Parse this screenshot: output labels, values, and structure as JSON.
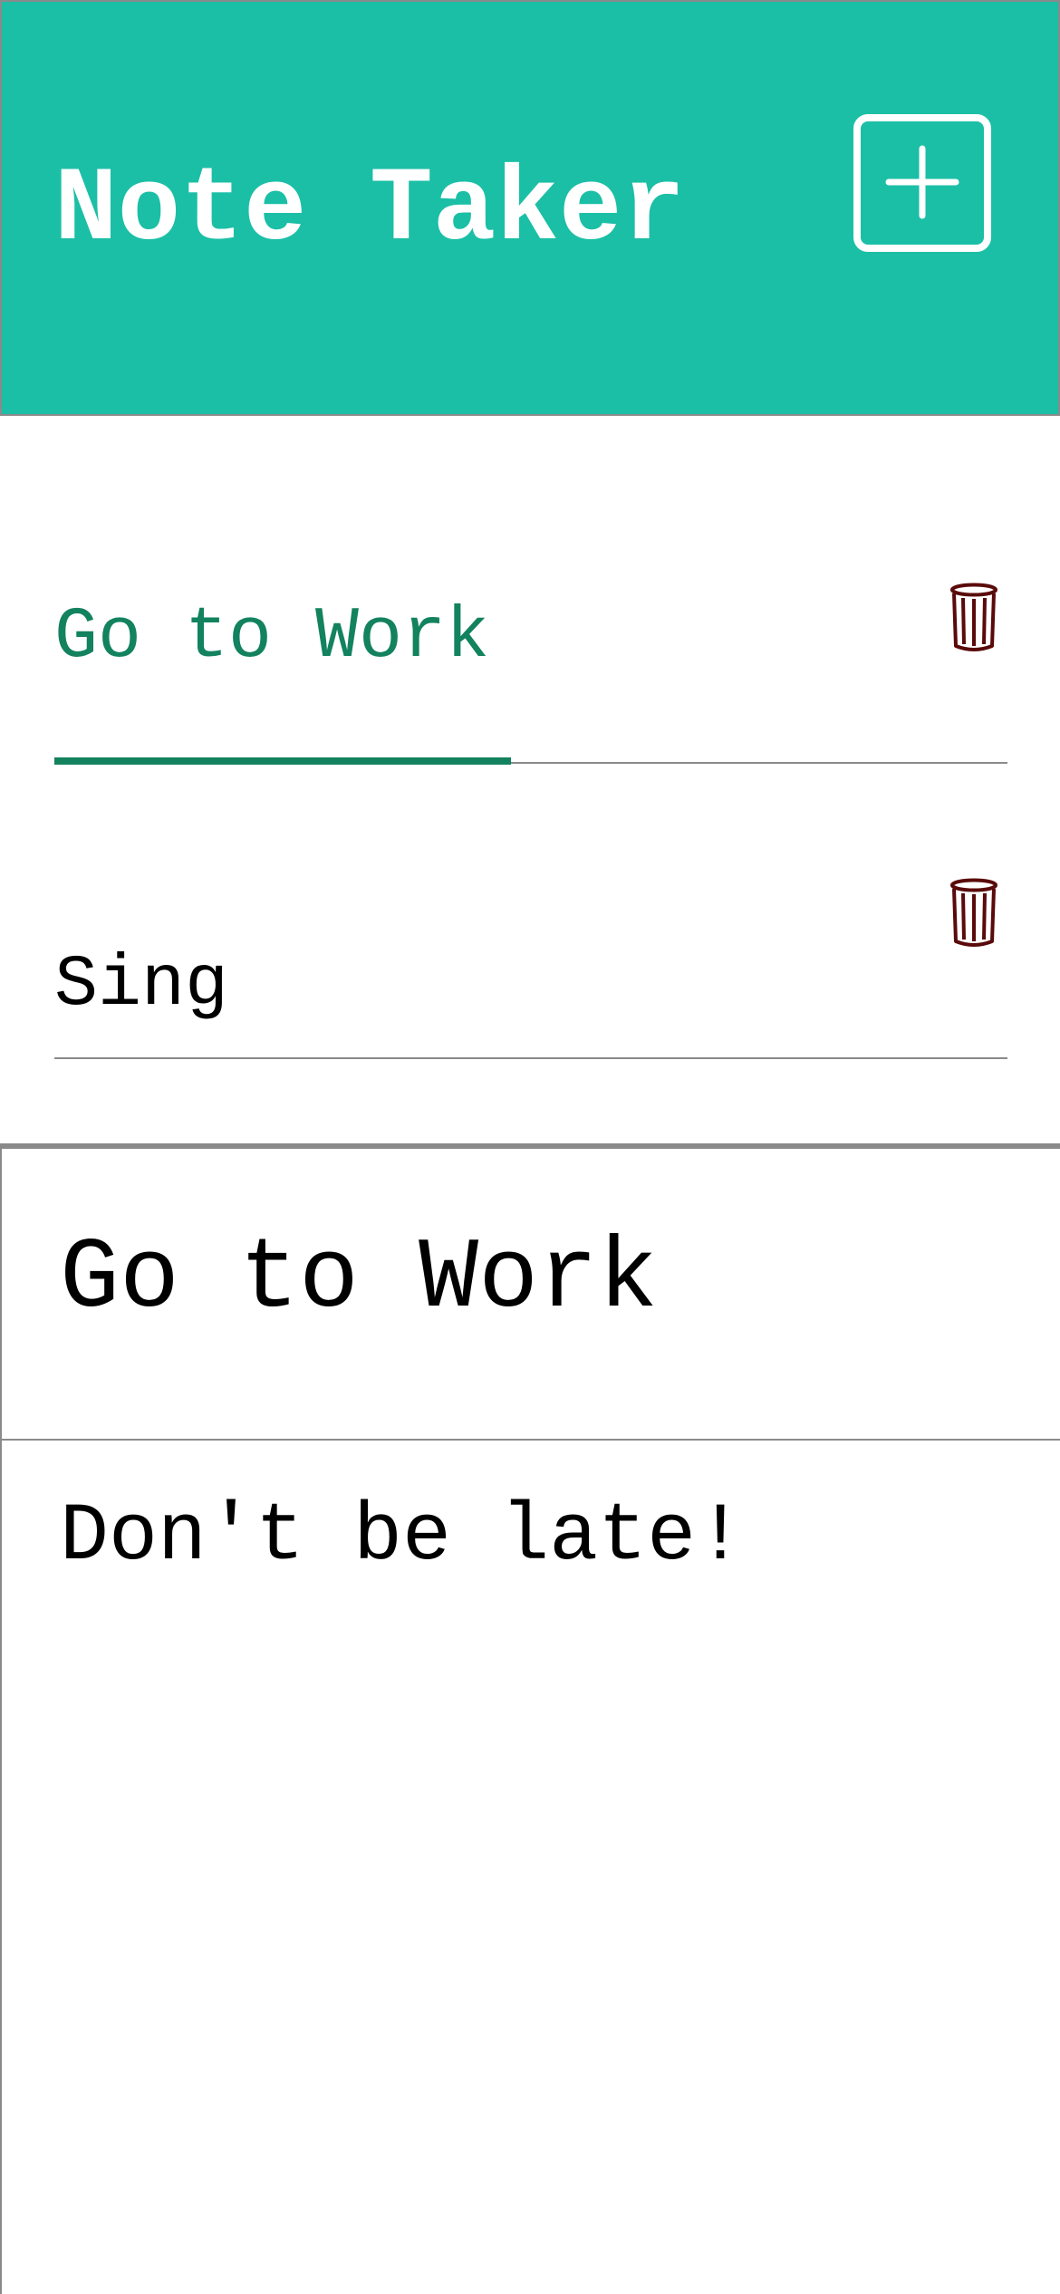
{
  "header": {
    "title": "Note Taker",
    "add_icon": "plus-square-icon",
    "background_color": "#1bbfa6"
  },
  "notes": [
    {
      "title": "Go to Work",
      "active": true,
      "delete_icon": "trash-icon"
    },
    {
      "title": "Sing",
      "active": false,
      "delete_icon": "trash-icon"
    }
  ],
  "editor": {
    "title": "Go to Work",
    "body": "Don't be late!"
  },
  "colors": {
    "accent": "#13825e",
    "trash": "#5a0a0a",
    "divider": "#8a8a8a"
  }
}
